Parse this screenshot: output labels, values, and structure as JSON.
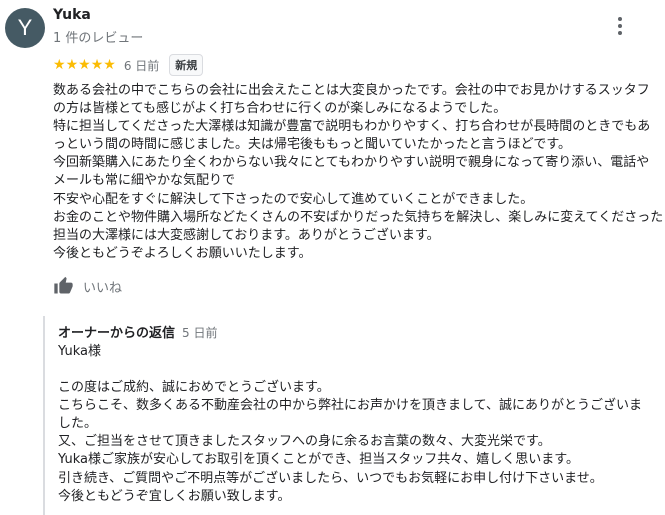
{
  "review": {
    "avatar_letter": "Y",
    "avatar_color": "#455a64",
    "author": "Yuka",
    "review_count": "1 件のレビュー",
    "menu_icon": "more-vert-icon",
    "rating": 5,
    "star_glyph": "★",
    "star_color": "#fbbc04",
    "date": "6 日前",
    "badge": "新規",
    "lines": [
      "数ある会社の中でこちらの会社に出会えたことは大変良かったです。会社の中でお見かけするスッタフ",
      "の方は皆様とても感じがよく打ち合わせに行くのが楽しみになるようでした。",
      "特に担当してくださった大澤様は知識が豊富で説明もわかりやすく、打ち合わせが長時間のときでもあ",
      "っという間の時間に感じました。夫は帰宅後ももっと聞いていたかったと言うほどです。",
      "今回新築購入にあたり全くわからない我々にとてもわかりやすい説明で親身になって寄り添い、電話や",
      "メールも常に細やかな気配りで",
      "不安や心配をすぐに解決して下さったので安心して進めていくことができました。",
      "お金のことや物件購入場所などたくさんの不安ばかりだった気持ちを解決し、楽しみに変えてくださった",
      "担当の大澤様には大変感謝しております。ありがとうございます。",
      "今後ともどうぞよろしくお願いいたします。"
    ],
    "like_icon": "thumb-up-icon",
    "like_label": "いいね"
  },
  "owner_reply": {
    "title": "オーナーからの返信",
    "date": "5 日前",
    "lines": [
      "Yuka様",
      "",
      "この度はご成約、誠におめでとうございます。",
      "こちらこそ、数多くある不動産会社の中から弊社にお声かけを頂きまして、誠にありがとうございま",
      "した。",
      "又、ご担当をさせて頂きましたスタッフへの身に余るお言葉の数々、大変光栄です。",
      "Yuka様ご家族が安心してお取引を頂くことができ、担当スタッフ共々、嬉しく思います。",
      "引き続き、ご質問やご不明点等がございましたら、いつでもお気軽にお申し付け下さいませ。",
      "今後ともどうぞ宜しくお願い致します。"
    ]
  }
}
